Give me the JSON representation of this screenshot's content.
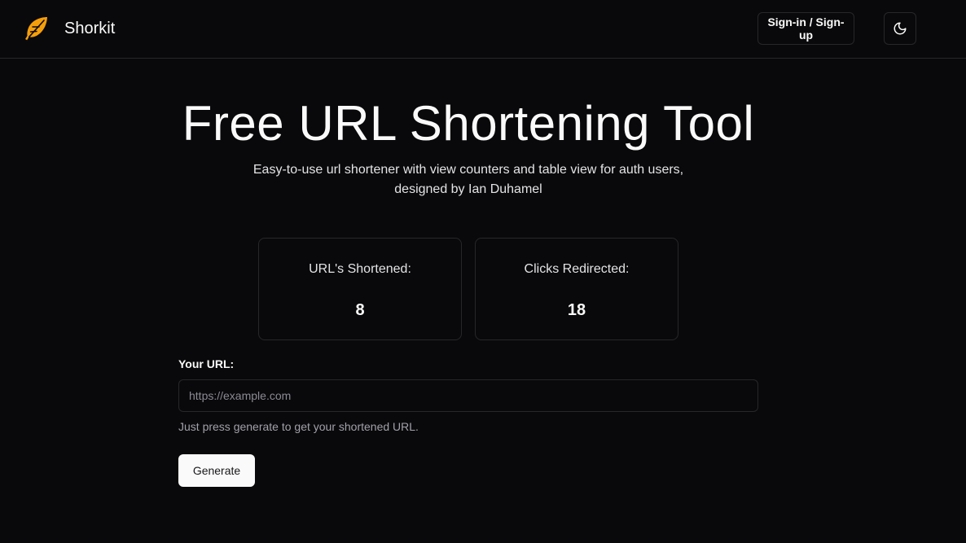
{
  "header": {
    "brand": "Shorkit",
    "signin_label": "Sign-in / Sign-up",
    "logo_icon": "feather-icon",
    "theme_icon": "moon-icon",
    "accent_color": "#f59e0b"
  },
  "hero": {
    "title": "Free URL Shortening Tool",
    "subtitle_line1": "Easy-to-use url shortener with view counters and table view for auth users,",
    "subtitle_line2": "designed by Ian Duhamel"
  },
  "stats": [
    {
      "label": "URL's Shortened:",
      "value": "8"
    },
    {
      "label": "Clicks Redirected:",
      "value": "18"
    }
  ],
  "form": {
    "url_label": "Your URL:",
    "url_placeholder": "https://example.com",
    "url_value": "",
    "helper_text": "Just press generate to get your shortened URL.",
    "generate_label": "Generate"
  }
}
